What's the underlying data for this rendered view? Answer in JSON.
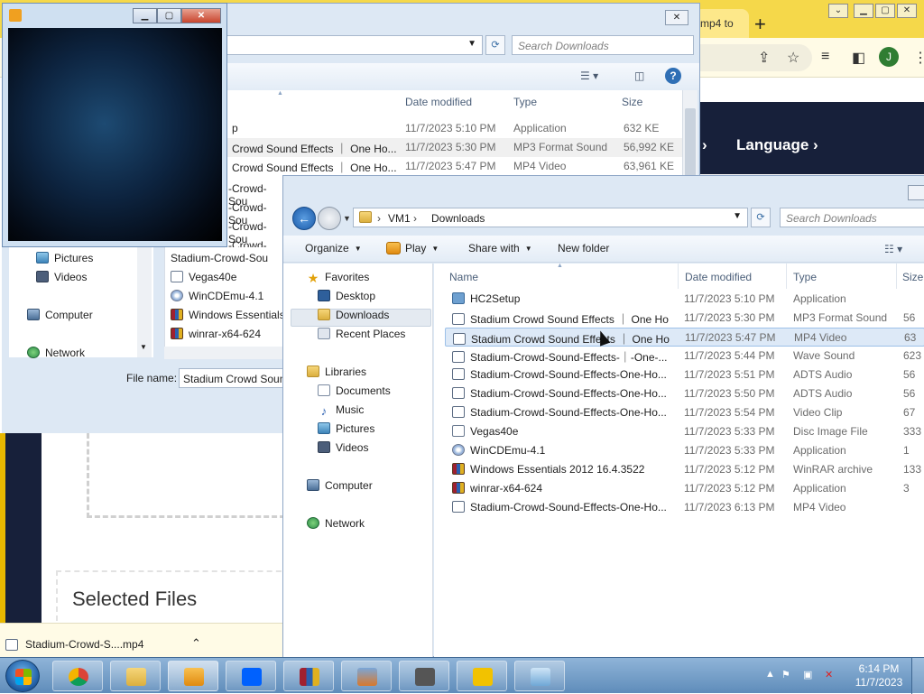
{
  "browser": {
    "tab_title": "mp4 to",
    "language_label": "Language",
    "avatar_letter": "J",
    "selected_files_title": "Selected Files",
    "download_file": "Stadium-Crowd-S....mp4"
  },
  "back_dialog": {
    "search_placeholder": "Search Downloads",
    "columns": {
      "date": "Date modified",
      "type": "Type",
      "size": "Size"
    },
    "rows": [
      {
        "name": "p",
        "date": "11/7/2023 5:10 PM",
        "type": "Application",
        "size": "632 KE"
      },
      {
        "name": "Crowd Sound Effects ｜ One Ho...",
        "date": "11/7/2023 5:30 PM",
        "type": "MP3 Format Sound",
        "size": "56,992 KE"
      },
      {
        "name": "Crowd Sound Effects ｜ One Ho...",
        "date": "11/7/2023 5:47 PM",
        "type": "MP4 Video",
        "size": "63,961 KE"
      }
    ],
    "lower_names": [
      "-Crowd-Sou",
      "-Crowd-Sou",
      "-Crowd-Sou",
      "-Crowd-Sou",
      "Stadium-Crowd-Sou",
      "Vegas40e",
      "WinCDEmu-4.1",
      "Windows Essentials",
      "winrar-x64-624"
    ],
    "nav": {
      "pictures": "Pictures",
      "videos": "Videos",
      "computer": "Computer",
      "network": "Network"
    },
    "filename_label": "File name:",
    "filename_value": "Stadium Crowd Sound Effects"
  },
  "front_dialog": {
    "breadcrumb": [
      "VM1",
      "Downloads"
    ],
    "search_placeholder": "Search Downloads",
    "toolbar": {
      "organize": "Organize",
      "play": "Play",
      "share": "Share with",
      "new_folder": "New folder"
    },
    "nav": {
      "favorites": "Favorites",
      "desktop": "Desktop",
      "downloads": "Downloads",
      "recent": "Recent Places",
      "libraries": "Libraries",
      "documents": "Documents",
      "music": "Music",
      "pictures": "Pictures",
      "videos": "Videos",
      "computer": "Computer",
      "network": "Network"
    },
    "columns": {
      "name": "Name",
      "date": "Date modified",
      "type": "Type",
      "size": "Size"
    },
    "files": [
      {
        "name": "HC2Setup",
        "date": "11/7/2023 5:10 PM",
        "type": "Application",
        "size": "",
        "icon": "app-icon"
      },
      {
        "name": "Stadium Crowd Sound Effects ｜ One Ho...",
        "date": "11/7/2023 5:30 PM",
        "type": "MP3 Format Sound",
        "size": "56",
        "icon": "media-icon"
      },
      {
        "name": "Stadium Crowd Sound Effects ｜ One Ho...",
        "date": "11/7/2023 5:47 PM",
        "type": "MP4 Video",
        "size": "63",
        "icon": "media-icon"
      },
      {
        "name": "Stadium-Crowd-Sound-Effects-｜-One-...",
        "date": "11/7/2023 5:44 PM",
        "type": "Wave Sound",
        "size": "623",
        "icon": "media-icon"
      },
      {
        "name": "Stadium-Crowd-Sound-Effects-One-Ho...",
        "date": "11/7/2023 5:51 PM",
        "type": "ADTS Audio",
        "size": "56",
        "icon": "media-icon"
      },
      {
        "name": "Stadium-Crowd-Sound-Effects-One-Ho...",
        "date": "11/7/2023 5:50 PM",
        "type": "ADTS Audio",
        "size": "56",
        "icon": "media-icon"
      },
      {
        "name": "Stadium-Crowd-Sound-Effects-One-Ho...",
        "date": "11/7/2023 5:54 PM",
        "type": "Video Clip",
        "size": "67",
        "icon": "media-icon"
      },
      {
        "name": "Vegas40e",
        "date": "11/7/2023 5:33 PM",
        "type": "Disc Image File",
        "size": "333",
        "icon": "disc-icon"
      },
      {
        "name": "WinCDEmu-4.1",
        "date": "11/7/2023 5:33 PM",
        "type": "Application",
        "size": "1",
        "icon": "cd-icon"
      },
      {
        "name": "Windows Essentials 2012 16.4.3522",
        "date": "11/7/2023 5:12 PM",
        "type": "WinRAR archive",
        "size": "133",
        "icon": "rar-icon"
      },
      {
        "name": "winrar-x64-624",
        "date": "11/7/2023 5:12 PM",
        "type": "Application",
        "size": "3",
        "icon": "rar-icon"
      },
      {
        "name": "Stadium-Crowd-Sound-Effects-One-Ho...",
        "date": "11/7/2023 6:13 PM",
        "type": "MP4 Video",
        "size": "",
        "icon": "media-icon"
      }
    ],
    "selected_index": 2
  },
  "taskbar": {
    "time": "6:14 PM",
    "date": "11/7/2023"
  },
  "colors": {
    "selection": "#dde9f7",
    "taskbar": "#6f9cc8",
    "accent": "#f5d84a"
  }
}
